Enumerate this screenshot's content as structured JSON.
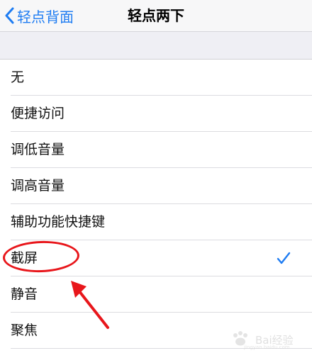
{
  "navbar": {
    "back_label": "轻点背面",
    "title": "轻点两下"
  },
  "options": [
    {
      "label": "无",
      "selected": false
    },
    {
      "label": "便捷访问",
      "selected": false
    },
    {
      "label": "调低音量",
      "selected": false
    },
    {
      "label": "调高音量",
      "selected": false
    },
    {
      "label": "辅助功能快捷键",
      "selected": false
    },
    {
      "label": "截屏",
      "selected": true
    },
    {
      "label": "静音",
      "selected": false
    },
    {
      "label": "聚焦",
      "selected": false
    }
  ],
  "colors": {
    "accent": "#1e7cf2",
    "annotation": "#e8161b",
    "group_background": "#efeff4"
  },
  "icons": {
    "back": "chevron-left-icon",
    "selected": "checkmark-icon"
  },
  "watermark": {
    "text": "Bai经验",
    "url": "jingyan.baidu.com"
  }
}
